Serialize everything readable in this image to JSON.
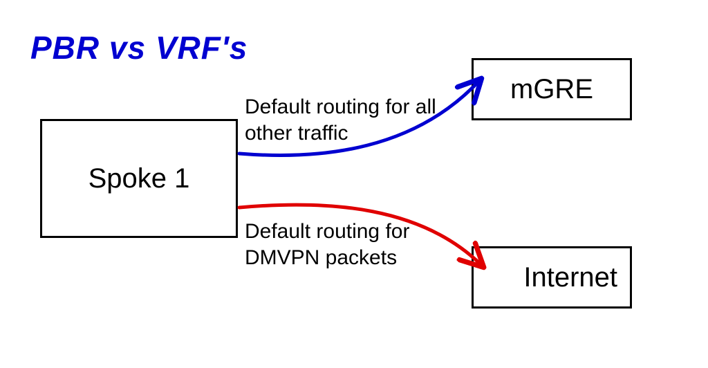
{
  "title": "PBR vs VRF's",
  "nodes": {
    "spoke": "Spoke 1",
    "mgre": "mGRE",
    "internet": "Internet"
  },
  "labels": {
    "top": "Default routing for all\nother traffic",
    "bottom": "Default routing for\nDMVPN packets"
  },
  "colors": {
    "title": "#0000d0",
    "arrow_top": "#0000d0",
    "arrow_bottom": "#e00000",
    "box_border": "#000000"
  }
}
